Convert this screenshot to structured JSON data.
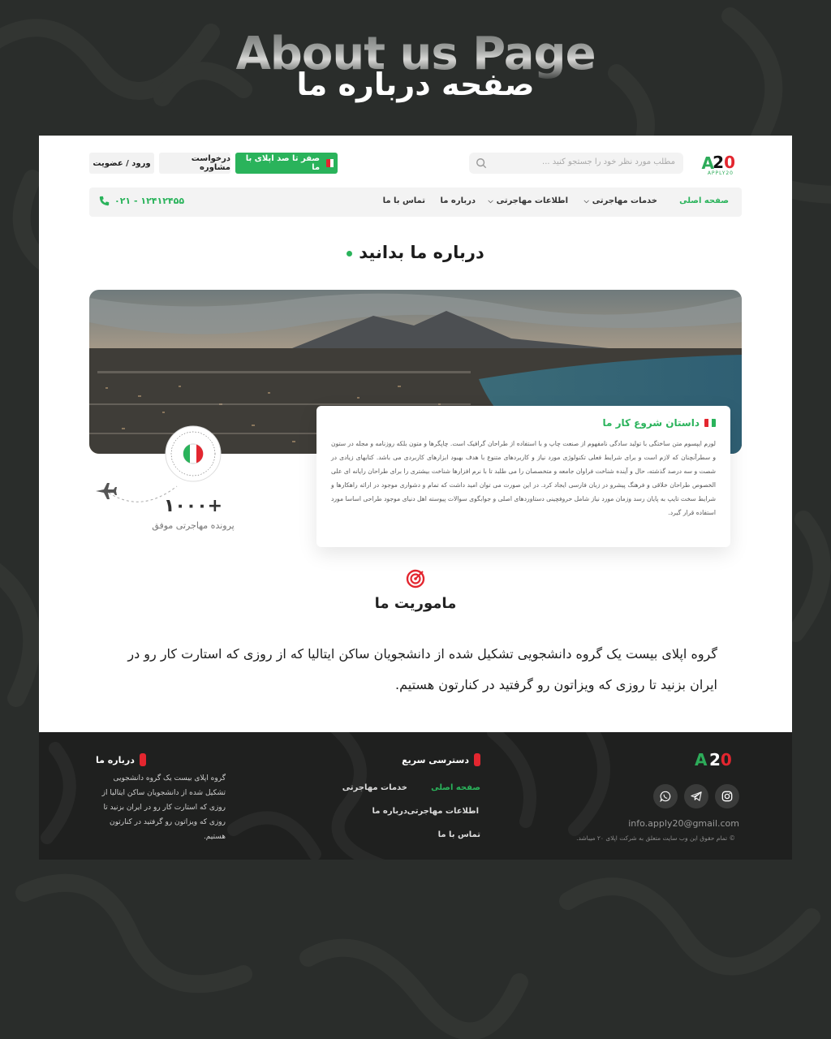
{
  "hero": {
    "title_en": "About us Page",
    "title_fa": "صفحه درباره ما"
  },
  "header": {
    "logo_mark": "A",
    "logo_num_a": "2",
    "logo_num_b": "0",
    "logo_sub": "APPLY20",
    "search_placeholder": "مطلب مورد نظر خود را جستجو کنید ...",
    "cta_label": "صفر تا صد اپلای با ما",
    "consult_label": "درخواست مشاوره",
    "login_label": "ورود / عضویت"
  },
  "nav": {
    "items": [
      {
        "label": "صفحه اصلی",
        "active": true
      },
      {
        "label": "خدمات مهاجرتی",
        "dropdown": true
      },
      {
        "label": "اطلاعات مهاجرتی",
        "dropdown": true
      },
      {
        "label": "درباره ما"
      },
      {
        "label": "تماس با ما"
      }
    ],
    "phone": "۰۲۱ - ۱۲۴۱۲۴۵۵"
  },
  "about": {
    "title": "درباره ما بدانید",
    "story_title": "داستان شروع کار ما",
    "story_body": "لورم ایپسوم متن ساختگی با تولید سادگی نامفهوم از صنعت چاپ و با استفاده از طراحان گرافیک است. چاپگرها و متون بلکه روزنامه و مجله در ستون و سطرآنچنان که لازم است و برای شرایط فعلی تکنولوژی مورد نیاز و کاربردهای متنوع با هدف بهبود ابزارهای کاربردی می باشد. کتابهای زیادی در شصت و سه درصد گذشته، حال و آینده شناخت فراوان جامعه و متخصصان را می طلبد تا با نرم افزارها شناخت بیشتری را برای طراحان رایانه ای علی الخصوص طراحان خلاقی و فرهنگ پیشرو در زبان فارسی ایجاد کرد. در این صورت می توان امید داشت که تمام و دشواری موجود در ارائه راهکارها و شرایط سخت تایپ به پایان رسد وزمان مورد نیاز شامل حروفچینی دستاوردهای اصلی و جوابگوی سوالات پیوسته اهل دنیای موجود طراحی اساسا مورد استفاده قرار گیرد.",
    "stamp_text": "LET'S GO TO ITALY",
    "stat_value": "+۱۰۰۰",
    "stat_label": "پرونده مهاجرتی موفق"
  },
  "mission": {
    "title": "ماموریت ما",
    "text": "گروه اپلای بیست یک گروه دانشجویی تشکیل شده از دانشجویان ساکن ایتالیا که از روزی که استارت کار رو در ایران بزنید تا روزی که ویزاتون رو گرفتید در کنارتون هستیم."
  },
  "footer": {
    "logo_mark": "A",
    "logo_num_a": "2",
    "logo_num_b": "0",
    "email": "info.apply20@gmail.com",
    "copyright": "© تمام حقوق این وب سایت متعلق به شرکت اپلای ۲۰ میباشد.",
    "quick_title": "دسترسی سریع",
    "links": [
      {
        "label": "صفحه اصلی",
        "active": true
      },
      {
        "label": "خدمات مهاجرتی"
      },
      {
        "label": "اطلاعات مهاجرتی"
      },
      {
        "label": "درباره ما"
      },
      {
        "label": "تماس با ما"
      }
    ],
    "about_title": "درباره ما",
    "about_text": "گروه اپلای بیست یک گروه دانشجویی تشکیل شده از دانشجویان ساکن ایتالیا از روزی که استارت کار رو در ایران بزنید تا روزی که ویزاتون رو گرفتید در کنارتون هستیم."
  },
  "colors": {
    "brand_green": "#2ab35b",
    "brand_red": "#e3262f",
    "background": "#2a2d2b"
  },
  "icons": [
    "search-icon",
    "italy-flag-icon",
    "phone-icon",
    "chevron-down-icon",
    "target-icon",
    "airplane-icon",
    "instagram-icon",
    "telegram-icon",
    "whatsapp-icon"
  ]
}
